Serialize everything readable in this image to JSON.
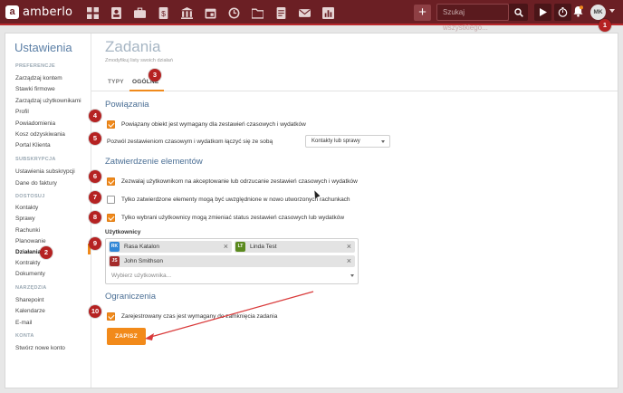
{
  "app": {
    "logo_letter": "a",
    "name": "amberlo",
    "accent": "#f08a1c",
    "topbar_color": "#6b1f24",
    "badge_color": "#b52222"
  },
  "topbar": {
    "nav_icons": [
      "dashboard-icon",
      "contacts-icon",
      "matters-icon",
      "invoices-icon",
      "bank-icon",
      "calendar-icon",
      "time-icon",
      "folder-icon",
      "documents-icon",
      "mail-icon",
      "reports-icon"
    ],
    "add_label": "+",
    "search_placeholder": "Szukaj wszystkiego...",
    "avatar_initials": "MK"
  },
  "sidebar": {
    "title": "Ustawienia",
    "groups": {
      "preferences": "PREFERENCJE",
      "subscription": "SUBSKRYPCJA",
      "access": "DOSTOSUJ",
      "tools": "NARZĘDZIA",
      "account": "KONTA"
    },
    "items": {
      "manage_account": "Zarządzaj kontem",
      "company_rates": "Stawki firmowe",
      "manage_users": "Zarządzaj użytkownikami",
      "profile": "Profil",
      "notifications": "Powiadomienia",
      "recycle_bin": "Kosz odzyskiwania",
      "client_portal": "Portal Klienta",
      "subscription_settings": "Ustawienia subskrypcji",
      "invoice_data": "Dane do faktury",
      "contacts": "Kontakty",
      "matters": "Sprawy",
      "invoices": "Rachunki",
      "planning": "Planowanie",
      "activities": "Działania",
      "contracts": "Kontrakty",
      "documents": "Dokumenty",
      "sharepoint": "Sharepoint",
      "calendars": "Kalendarze",
      "email": "E-mail",
      "create_account": "Stwórz nowe konto"
    }
  },
  "main": {
    "title": "Zadania",
    "subtitle": "Zmodyfikuj listy swoich działań",
    "tabs": [
      "TYPY",
      "OGÓLNE"
    ],
    "sections": {
      "links": "Powiązania",
      "approval": "Zatwierdzenie elementów",
      "limits": "Ograniczenia"
    },
    "options": {
      "linked_required": "Powiązany obiekt jest wymagany dla zestawień czasowych i wydatków",
      "allow_link_prefix": "Pozwól zestawieniom czasowym i wydatkom łączyć się ze sobą",
      "allow_link_value": "Kontakty lub sprawy",
      "allow_approve": "Zezwalaj użytkownikom na akceptowanie lub odrzucanie zestawień czasowych i wydatków",
      "only_approved": "Tylko zatwierdzone elementy mogą być uwzględnione w nowo utworzonych rachunkach",
      "only_selected": "Tylko wybrani użytkownicy mogą zmieniać status zestawień czasowych lub wydatków",
      "time_required": "Zarejestrowany czas jest wymagany do zamknięcia zadania"
    },
    "users": {
      "label": "Użytkownicy",
      "chips": [
        {
          "initials": "RK",
          "name": "Rasa Katalon",
          "color": "#2f86d6"
        },
        {
          "initials": "LT",
          "name": "Linda Test",
          "color": "#5b8a1e"
        },
        {
          "initials": "JS",
          "name": "John Smithson",
          "color": "#a42b2b"
        }
      ],
      "placeholder": "Wybierz użytkownika..."
    },
    "save_label": "ZAPISZ"
  },
  "callouts": [
    "1",
    "2",
    "3",
    "4",
    "5",
    "6",
    "7",
    "8",
    "9",
    "10"
  ]
}
